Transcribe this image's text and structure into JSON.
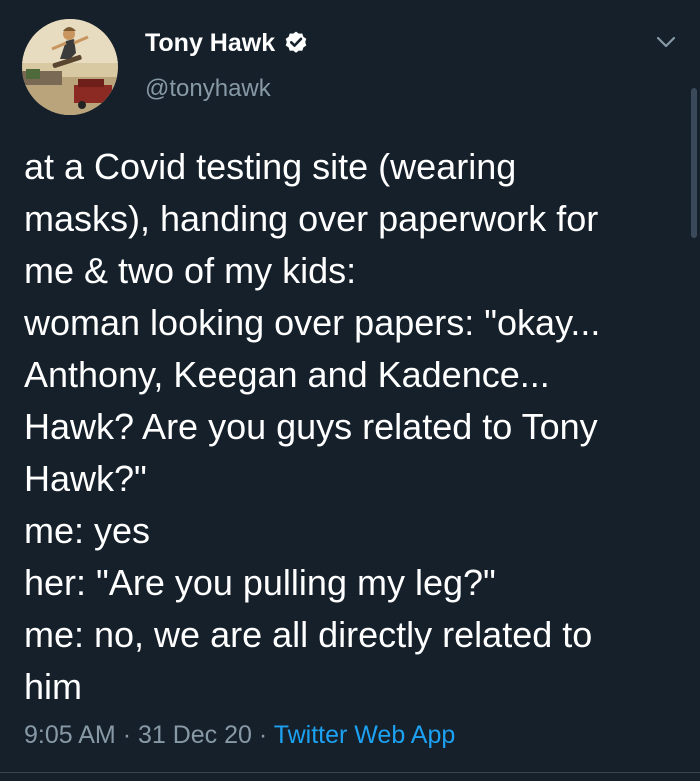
{
  "author": {
    "display_name": "Tony Hawk",
    "handle": "@tonyhawk",
    "verified": true
  },
  "tweet": {
    "lines": [
      "at a Covid testing site (wearing",
      "masks), handing over paperwork for",
      "me & two of my kids:",
      "woman looking over papers: \"okay...",
      "Anthony, Keegan and Kadence...",
      "Hawk? Are you guys related to Tony",
      "Hawk?\"",
      "me: yes",
      "her: \"Are you pulling my leg?\"",
      "me: no, we are all directly related to",
      "him"
    ]
  },
  "meta": {
    "time": "9:05 AM",
    "separator": "·",
    "date": "31 Dec 20",
    "source": "Twitter Web App"
  },
  "icons": {
    "avatar": "skateboarder-photo-avatar",
    "verified": "verified-badge-icon",
    "menu": "chevron-down-icon"
  },
  "colors": {
    "background": "#15202b",
    "primary_text": "#ffffff",
    "secondary_text": "#8899a6",
    "link": "#1da1f2"
  }
}
